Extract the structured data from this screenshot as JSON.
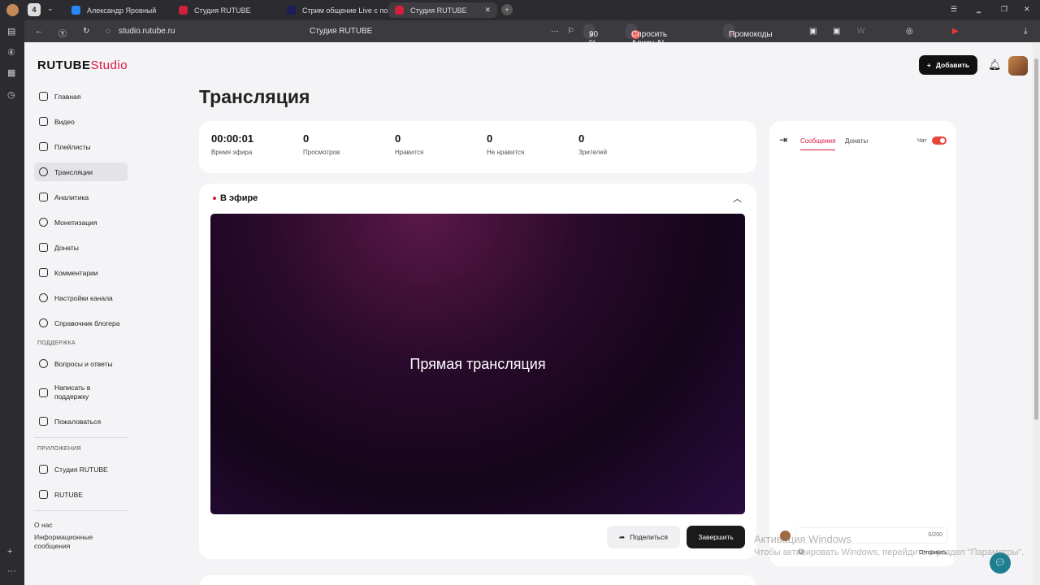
{
  "browser": {
    "tab_count": "4",
    "tabs": [
      {
        "label": "Александр Яровный"
      },
      {
        "label": "Студия RUTUBE"
      },
      {
        "label": "Стрим общение Live с по"
      },
      {
        "label": "Студия RUTUBE"
      }
    ],
    "url": "studio.rutube.ru",
    "page_title": "Студия RUTUBE",
    "zoom": "90 %",
    "alice": "Спросить Алису AI",
    "promo": "Промокоды"
  },
  "logo": {
    "brand": "RUTUBE",
    "suffix": "Studio"
  },
  "sidebar": {
    "items": [
      {
        "label": "Главная"
      },
      {
        "label": "Видео"
      },
      {
        "label": "Плейлисты"
      },
      {
        "label": "Трансляции"
      },
      {
        "label": "Аналитика"
      },
      {
        "label": "Монетизация"
      },
      {
        "label": "Донаты"
      },
      {
        "label": "Комментарии"
      },
      {
        "label": "Настройки канала"
      },
      {
        "label": "Справочник блогера"
      }
    ],
    "support_title": "ПОДДЕРЖКА",
    "support": [
      {
        "label": "Вопросы и ответы"
      },
      {
        "label": "Написать в поддержку"
      },
      {
        "label": "Пожаловаться"
      }
    ],
    "apps_title": "ПРИЛОЖЕНИЯ",
    "apps": [
      {
        "label": "Студия RUTUBE"
      },
      {
        "label": "RUTUBE"
      }
    ],
    "footer": [
      {
        "label": "О нас"
      },
      {
        "label": "Информационные сообщения"
      }
    ]
  },
  "header": {
    "add_label": "Добавить"
  },
  "main": {
    "title": "Трансляция",
    "stats": [
      {
        "value": "00:00:01",
        "label": "Время эфира"
      },
      {
        "value": "0",
        "label": "Просмотров"
      },
      {
        "value": "0",
        "label": "Нравится"
      },
      {
        "value": "0",
        "label": "Не нравится"
      },
      {
        "value": "0",
        "label": "Зрителей"
      }
    ],
    "live_label": "В эфире",
    "video_text": "Прямая трансляция",
    "share_label": "Поделиться",
    "finish_label": "Завершить"
  },
  "chat": {
    "tabs": [
      {
        "label": "Сообщения"
      },
      {
        "label": "Донаты"
      }
    ],
    "chat_label": "Чат",
    "counter": "0/200",
    "send_label": "Отправить"
  },
  "watermark": {
    "line1": "Активация Windows",
    "line2": "Чтобы активировать Windows, перейдите в раздел \"Параметры\"."
  },
  "colors": {
    "accent": "#e0143c",
    "toggle": "#e8453c",
    "help": "#1d7f8f"
  }
}
